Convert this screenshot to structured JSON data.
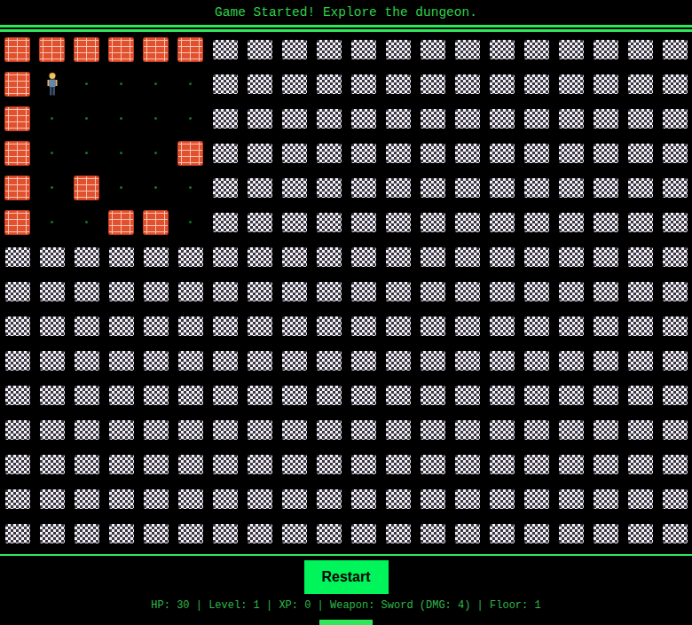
{
  "message": "Game Started! Explore the dungeon.",
  "map": {
    "rows": [
      [
        "wall",
        "wall",
        "wall",
        "wall",
        "wall",
        "wall",
        "fog",
        "fog",
        "fog",
        "fog",
        "fog",
        "fog",
        "fog",
        "fog",
        "fog",
        "fog",
        "fog",
        "fog",
        "fog",
        "fog"
      ],
      [
        "wall",
        "player",
        "floor",
        "floor",
        "floor",
        "floor",
        "fog",
        "fog",
        "fog",
        "fog",
        "fog",
        "fog",
        "fog",
        "fog",
        "fog",
        "fog",
        "fog",
        "fog",
        "fog",
        "fog"
      ],
      [
        "wall",
        "floor",
        "floor",
        "floor",
        "floor",
        "floor",
        "fog",
        "fog",
        "fog",
        "fog",
        "fog",
        "fog",
        "fog",
        "fog",
        "fog",
        "fog",
        "fog",
        "fog",
        "fog",
        "fog"
      ],
      [
        "wall",
        "floor",
        "floor",
        "floor",
        "floor",
        "wall",
        "fog",
        "fog",
        "fog",
        "fog",
        "fog",
        "fog",
        "fog",
        "fog",
        "fog",
        "fog",
        "fog",
        "fog",
        "fog",
        "fog"
      ],
      [
        "wall",
        "floor",
        "wall",
        "floor",
        "floor",
        "floor",
        "fog",
        "fog",
        "fog",
        "fog",
        "fog",
        "fog",
        "fog",
        "fog",
        "fog",
        "fog",
        "fog",
        "fog",
        "fog",
        "fog"
      ],
      [
        "wall",
        "floor",
        "floor",
        "wall",
        "wall",
        "floor",
        "fog",
        "fog",
        "fog",
        "fog",
        "fog",
        "fog",
        "fog",
        "fog",
        "fog",
        "fog",
        "fog",
        "fog",
        "fog",
        "fog"
      ],
      [
        "fog",
        "fog",
        "fog",
        "fog",
        "fog",
        "fog",
        "fog",
        "fog",
        "fog",
        "fog",
        "fog",
        "fog",
        "fog",
        "fog",
        "fog",
        "fog",
        "fog",
        "fog",
        "fog",
        "fog"
      ],
      [
        "fog",
        "fog",
        "fog",
        "fog",
        "fog",
        "fog",
        "fog",
        "fog",
        "fog",
        "fog",
        "fog",
        "fog",
        "fog",
        "fog",
        "fog",
        "fog",
        "fog",
        "fog",
        "fog",
        "fog"
      ],
      [
        "fog",
        "fog",
        "fog",
        "fog",
        "fog",
        "fog",
        "fog",
        "fog",
        "fog",
        "fog",
        "fog",
        "fog",
        "fog",
        "fog",
        "fog",
        "fog",
        "fog",
        "fog",
        "fog",
        "fog"
      ],
      [
        "fog",
        "fog",
        "fog",
        "fog",
        "fog",
        "fog",
        "fog",
        "fog",
        "fog",
        "fog",
        "fog",
        "fog",
        "fog",
        "fog",
        "fog",
        "fog",
        "fog",
        "fog",
        "fog",
        "fog"
      ],
      [
        "fog",
        "fog",
        "fog",
        "fog",
        "fog",
        "fog",
        "fog",
        "fog",
        "fog",
        "fog",
        "fog",
        "fog",
        "fog",
        "fog",
        "fog",
        "fog",
        "fog",
        "fog",
        "fog",
        "fog"
      ],
      [
        "fog",
        "fog",
        "fog",
        "fog",
        "fog",
        "fog",
        "fog",
        "fog",
        "fog",
        "fog",
        "fog",
        "fog",
        "fog",
        "fog",
        "fog",
        "fog",
        "fog",
        "fog",
        "fog",
        "fog"
      ],
      [
        "fog",
        "fog",
        "fog",
        "fog",
        "fog",
        "fog",
        "fog",
        "fog",
        "fog",
        "fog",
        "fog",
        "fog",
        "fog",
        "fog",
        "fog",
        "fog",
        "fog",
        "fog",
        "fog",
        "fog"
      ],
      [
        "fog",
        "fog",
        "fog",
        "fog",
        "fog",
        "fog",
        "fog",
        "fog",
        "fog",
        "fog",
        "fog",
        "fog",
        "fog",
        "fog",
        "fog",
        "fog",
        "fog",
        "fog",
        "fog",
        "fog"
      ],
      [
        "fog",
        "fog",
        "fog",
        "fog",
        "fog",
        "fog",
        "fog",
        "fog",
        "fog",
        "fog",
        "fog",
        "fog",
        "fog",
        "fog",
        "fog",
        "fog",
        "fog",
        "fog",
        "fog",
        "fog"
      ]
    ]
  },
  "buttons": {
    "restart": "Restart"
  },
  "status": "HP: 30 | Level: 1 | XP: 0 | Weapon: Sword (DMG: 4) | Floor: 1"
}
